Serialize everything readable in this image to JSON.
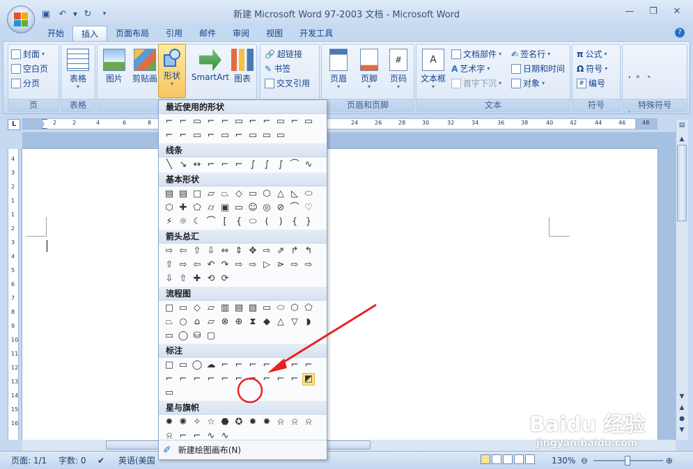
{
  "window": {
    "title": "新建 Microsoft Word 97-2003 文档 - Microsoft Word"
  },
  "tabs": [
    "开始",
    "插入",
    "页面布局",
    "引用",
    "邮件",
    "审阅",
    "视图",
    "开发工具"
  ],
  "ribbon": {
    "pages_group": {
      "label": "页",
      "items": [
        "封面",
        "空白页",
        "分页"
      ]
    },
    "table_group": {
      "label": "表格",
      "button": "表格"
    },
    "illus_group": {
      "buttons": [
        "图片",
        "剪贴画",
        "形状",
        "SmartArt",
        "图表"
      ]
    },
    "links_group": {
      "items": [
        "超链接",
        "书签",
        "交叉引用"
      ]
    },
    "hf_group": {
      "label": "页眉和页脚",
      "buttons": [
        "页眉",
        "页脚",
        "页码"
      ]
    },
    "text_group": {
      "label": "文本",
      "big": "文本框",
      "items": [
        "文档部件",
        "艺术字",
        "首字下沉",
        "签名行",
        "日期和时间",
        "对象"
      ]
    },
    "symbols_group": {
      "label": "符号",
      "items": [
        "公式",
        "符号",
        "编号"
      ]
    },
    "special_group": {
      "label": "特殊符号",
      "rows": [
        ",  。 、",
        ";  ：  ？"
      ],
      "button": "符号"
    }
  },
  "ruler": {
    "ticks": [
      "2",
      "2",
      "4",
      "6",
      "8",
      "24",
      "26",
      "28",
      "30",
      "32",
      "34",
      "36",
      "38",
      "40",
      "42",
      "44",
      "46",
      "48"
    ]
  },
  "dropdown": {
    "sections": [
      {
        "title": "最近使用的形状"
      },
      {
        "title": "线条"
      },
      {
        "title": "基本形状"
      },
      {
        "title": "箭头总汇"
      },
      {
        "title": "流程图"
      },
      {
        "title": "标注"
      },
      {
        "title": "星与旗帜"
      }
    ],
    "new_canvas": "新建绘图画布(N)"
  },
  "status": {
    "page": "页面: 1/1",
    "words": "字数: 0",
    "language": "英语(美国",
    "zoom": "130%"
  },
  "watermark": {
    "brand": "Baidu 经验",
    "url": "jingyan.baidu.com"
  },
  "colors": {
    "accent": "#15428b",
    "highlight": "#fbe38e",
    "annotation": "#e8221f"
  }
}
